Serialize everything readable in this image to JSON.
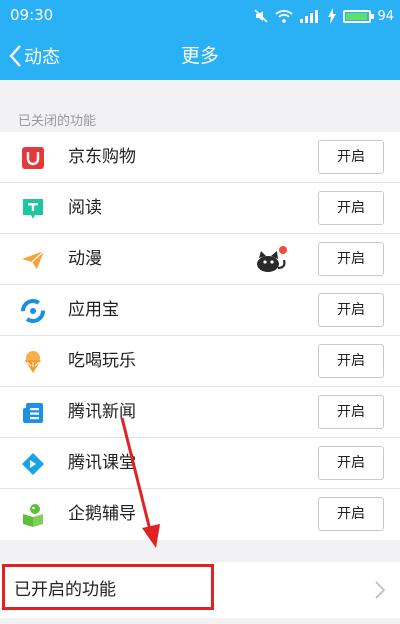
{
  "status": {
    "time": "09:30",
    "battery": "94",
    "battery_level": 0.94
  },
  "nav": {
    "back_label": "动态",
    "title": "更多"
  },
  "disabled_section": {
    "label": "已关闭的功能",
    "items": [
      {
        "label": "京东购物",
        "button": "开启",
        "icon": "jd-shopping-icon",
        "color": "#e4393c"
      },
      {
        "label": "阅读",
        "button": "开启",
        "icon": "reading-icon",
        "color": "#1bc6a0"
      },
      {
        "label": "动漫",
        "button": "开启",
        "icon": "comic-icon",
        "color": "#f7a23a"
      },
      {
        "label": "应用宝",
        "button": "开启",
        "icon": "app-store-icon",
        "color": "#1a8fe3"
      },
      {
        "label": "吃喝玩乐",
        "button": "开启",
        "icon": "food-fun-icon",
        "color": "#f79b2e"
      },
      {
        "label": "腾讯新闻",
        "button": "开启",
        "icon": "tencent-news-icon",
        "color": "#1e90e6"
      },
      {
        "label": "腾讯课堂",
        "button": "开启",
        "icon": "tencent-class-icon",
        "color": "#1aa3e8"
      },
      {
        "label": "企鹅辅导",
        "button": "开启",
        "icon": "penguin-tutor-icon",
        "color": "#5bbf3a"
      }
    ]
  },
  "enabled_section": {
    "label": "已开启的功能"
  },
  "colors": {
    "header": "#2ab0f4",
    "highlight": "#e02222"
  }
}
